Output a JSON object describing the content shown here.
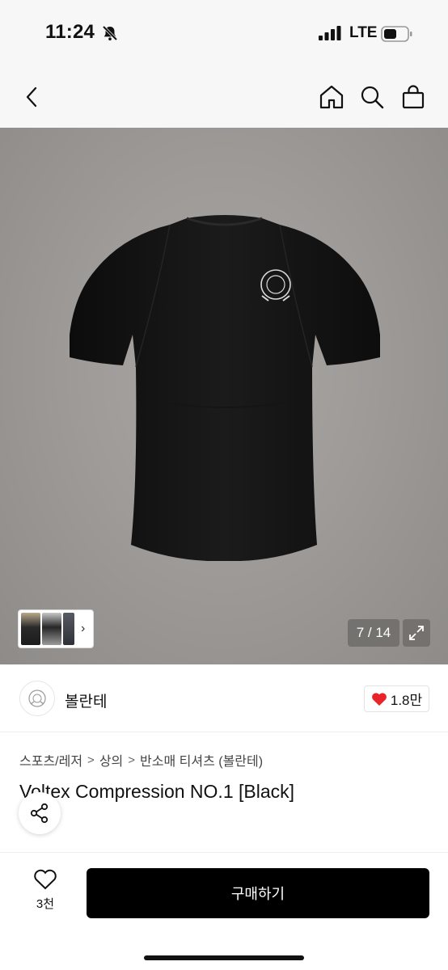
{
  "status_bar": {
    "time": "11:24",
    "network": "LTE"
  },
  "nav": {
    "icons": [
      "chevron-left-icon",
      "home-icon",
      "search-icon",
      "shopping-bag-icon"
    ]
  },
  "gallery": {
    "counter": "7 / 14",
    "thumbnail_arrow": "›"
  },
  "brand": {
    "name": "볼란테",
    "likes": "1.8만",
    "heart_color": "#e8242a"
  },
  "breadcrumb": {
    "items": [
      "스포츠/레저",
      "상의",
      "반소매 티셔츠 (볼란테)"
    ],
    "separator": ">"
  },
  "product": {
    "title": "Voltex Compression NO.1 [Black]"
  },
  "bottom_bar": {
    "wish_count": "3천",
    "buy_label": "구매하기",
    "buy_color": "#000000"
  }
}
